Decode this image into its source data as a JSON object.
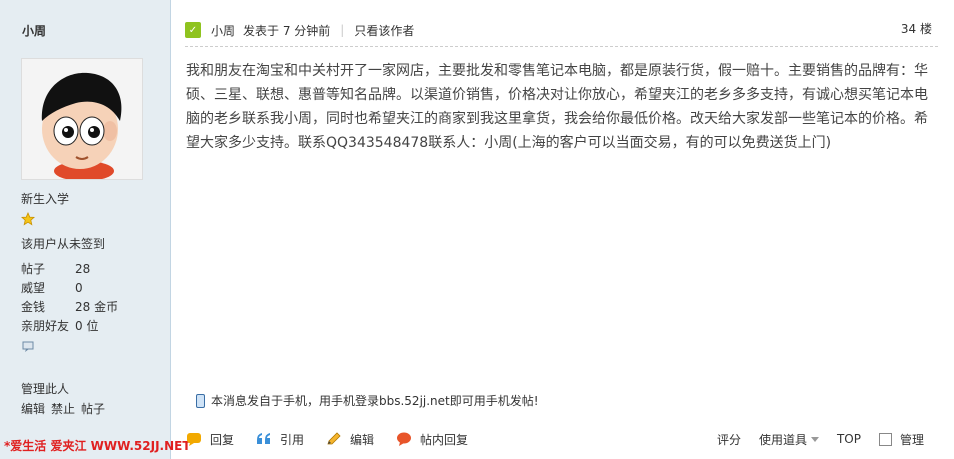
{
  "sidebar": {
    "username": "小周",
    "rank": "新生入学",
    "sign_status": "该用户从未签到",
    "stats": [
      {
        "label": "帖子",
        "value": "28"
      },
      {
        "label": "威望",
        "value": "0"
      },
      {
        "label": "金钱",
        "value": "28 金币"
      },
      {
        "label": "亲朋好友",
        "value": "0 位"
      }
    ],
    "manage_title": "管理此人",
    "manage_links": [
      "编辑",
      "禁止",
      "帖子"
    ],
    "watermark": "*爱生活  爱夹江 WWW.52JJ.NET"
  },
  "post": {
    "author": "小周",
    "posted_at": "发表于  7 分钟前",
    "only_author": "只看该作者",
    "floor": "34 楼",
    "body": "我和朋友在淘宝和中关村开了一家网店，主要批发和零售笔记本电脑，都是原装行货，假一赔十。主要销售的品牌有：华硕、三星、联想、惠普等知名品牌。以渠道价销售，价格决对让你放心，希望夹江的老乡多多支持，有诚心想买笔记本电脑的老乡联系我小周，同时也希望夹江的商家到我这里拿货，我会给你最低价格。改天给大家发部一些笔记本的价格。希望大家多少支持。联系QQ343548478联系人：小周(上海的客户可以当面交易，有的可以免费送货上门)",
    "mobile_note": "本消息发自于手机，用手机登录bbs.52jj.net即可用手机发帖!"
  },
  "actions": {
    "reply": "回复",
    "quote": "引用",
    "edit": "编辑",
    "inline_reply": "帖内回复",
    "rate": "评分",
    "tools": "使用道具",
    "top": "TOP",
    "manage": "管理"
  },
  "colors": {
    "sidebar_bg": "#E5EDF2",
    "watermark": "#E02020",
    "online": "#8FC31F"
  }
}
